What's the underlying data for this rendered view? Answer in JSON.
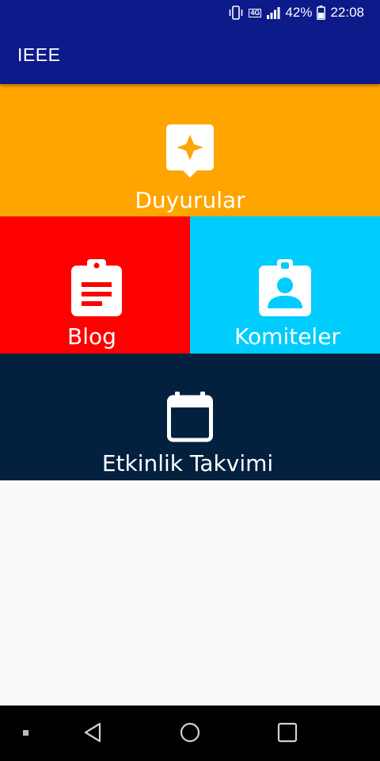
{
  "status_bar": {
    "network": "4G",
    "battery": "42%",
    "time": "22:08"
  },
  "app_bar": {
    "title": "IEEE"
  },
  "tiles": [
    {
      "label": "Duyurular",
      "icon": "announcement-icon",
      "color": "#ffa500"
    },
    {
      "label": "Blog",
      "icon": "clipboard-icon",
      "color": "#ff0000"
    },
    {
      "label": "Komiteler",
      "icon": "badge-icon",
      "color": "#00ccfe"
    },
    {
      "label": "Etkinlik Takvimi",
      "icon": "calendar-icon",
      "color": "#03213f"
    }
  ],
  "nav_bar": {
    "buttons": [
      "menu-dot-icon",
      "back-icon",
      "home-icon",
      "recents-icon"
    ]
  }
}
